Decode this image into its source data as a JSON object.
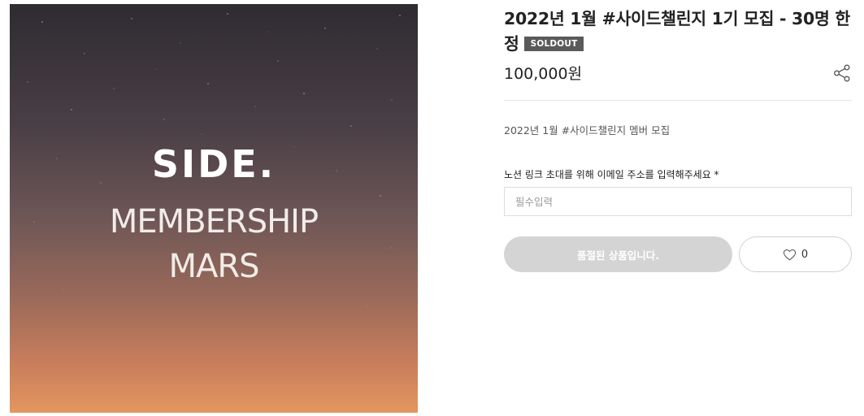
{
  "product": {
    "image": {
      "line_side": "SIDE.",
      "line_membership": "MEMBERSHIP",
      "line_mars": "MARS"
    },
    "title": "2022년 1월 #사이드챌린지 1기 모집 - 30명 한정",
    "badge": "SOLDOUT",
    "price": "100,000원",
    "description": "2022년 1월 #사이드챌린지 멤버 모집",
    "icons": {
      "share": "share-icon",
      "wishlist": "heart-icon"
    }
  },
  "form": {
    "email_label": "노션 링크 초대를 위해 이메일 주소를 입력해주세요 *",
    "email_placeholder": "필수입력",
    "email_value": ""
  },
  "actions": {
    "soldout_label": "품절된 상품입니다.",
    "wish_count": "0"
  },
  "colors": {
    "badge_bg": "#5a5a5a",
    "soldout_button_bg": "#d4d4d4",
    "image_gradient_top": "#2f2b32",
    "image_gradient_bottom": "#e3965e"
  }
}
